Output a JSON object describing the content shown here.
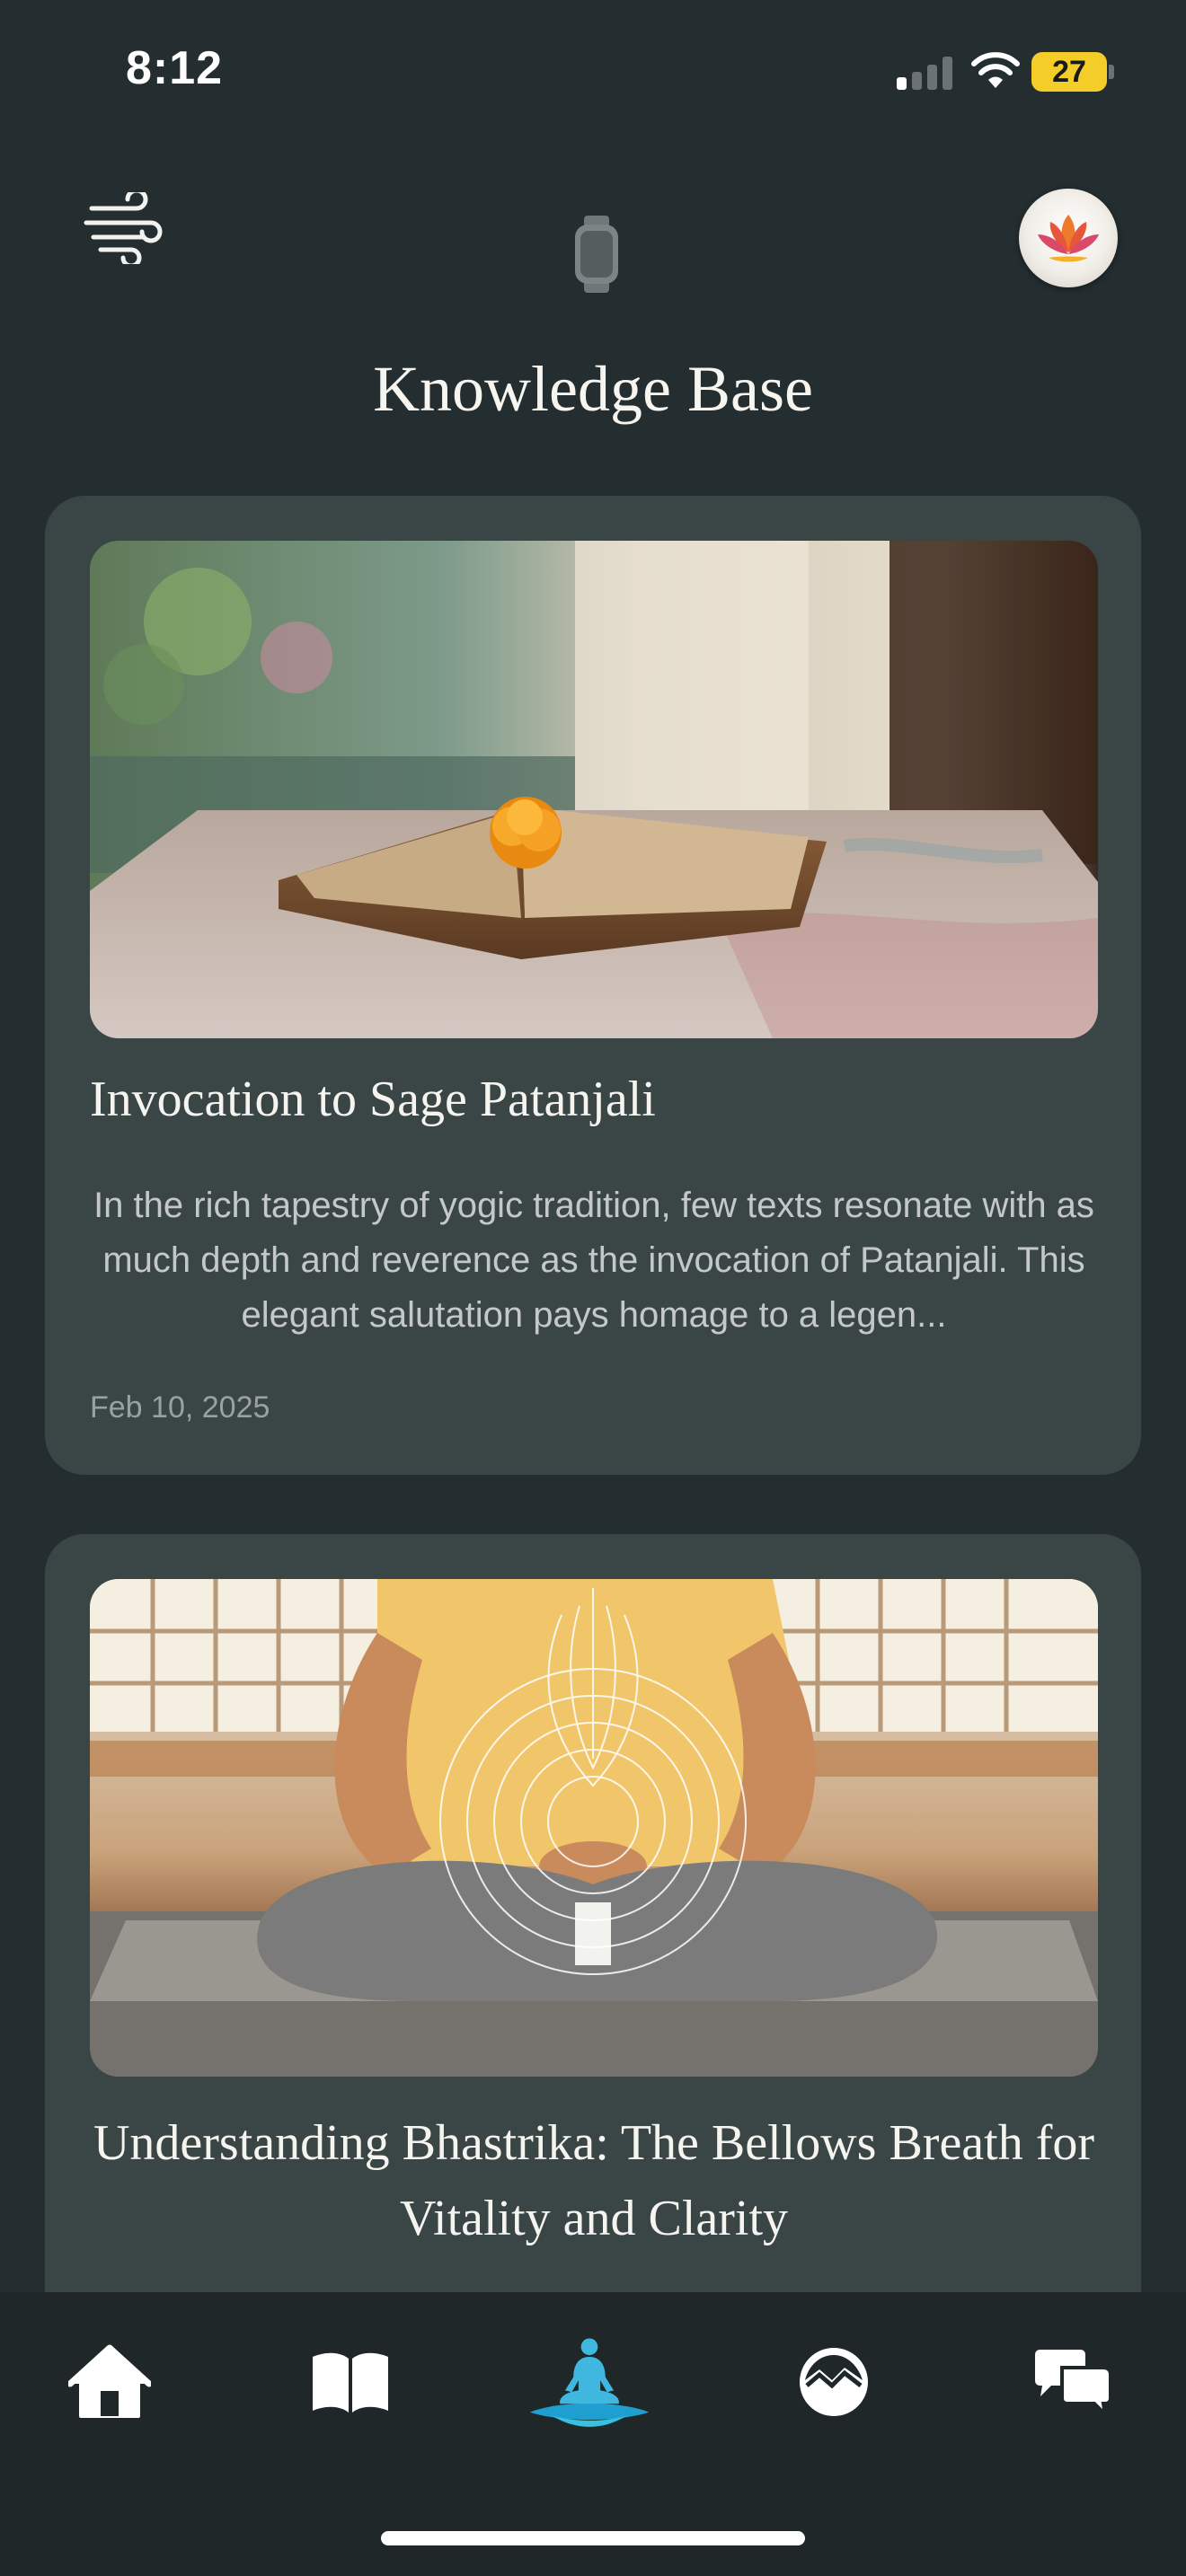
{
  "status_bar": {
    "time": "8:12",
    "battery_level": "27",
    "signal_bars_active": 1,
    "signal_bars_total": 4
  },
  "header": {
    "menu_icon": "wind-lines-icon",
    "center_icon": "smartwatch-icon",
    "avatar_icon": "lotus-icon"
  },
  "page": {
    "title": "Knowledge Base"
  },
  "articles": [
    {
      "title": "Invocation to Sage Patanjali",
      "excerpt": "In the rich tapestry of yogic tradition, few texts resonate with as much depth and reverence as the invocation of Patanjali. This elegant salutation pays homage to a legen...",
      "date": "Feb 10, 2025",
      "image": "open-book-with-marigold-image"
    },
    {
      "title": "Understanding Bhastrika: The Bellows Breath for Vitality and Clarity",
      "image": "seated-meditation-breath-rings-image"
    }
  ],
  "tab_bar": {
    "tabs": [
      {
        "name": "home",
        "icon": "house-icon"
      },
      {
        "name": "library",
        "icon": "open-book-icon"
      },
      {
        "name": "meditate",
        "icon": "meditating-figure-icon",
        "active": true
      },
      {
        "name": "explore",
        "icon": "landscape-circle-icon"
      },
      {
        "name": "chat",
        "icon": "chat-bubbles-icon"
      }
    ]
  },
  "colors": {
    "background": "#242e30",
    "card": "#3a4546",
    "tab_bar": "#1f2729",
    "accent_teal": "#2fb4d6",
    "battery": "#f5cd28"
  }
}
